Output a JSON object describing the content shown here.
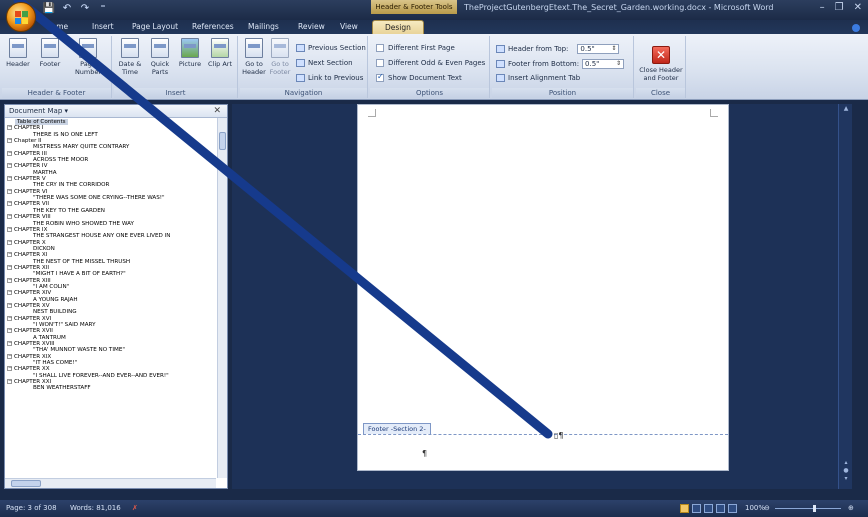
{
  "window": {
    "context_title": "Header & Footer Tools",
    "title": "TheProjectGutenbergEtext.The_Secret_Garden.working.docx - Microsoft Word",
    "minimize": "–",
    "restore": "❐",
    "close": "✕"
  },
  "qat": {
    "save": "💾",
    "undo": "↶",
    "redo": "↷",
    "more": "⁼"
  },
  "tabs": [
    "Home",
    "Insert",
    "Page Layout",
    "References",
    "Mailings",
    "Review",
    "View",
    "Design"
  ],
  "active_tab": "Design",
  "ribbon": {
    "header_footer": {
      "label": "Header & Footer",
      "header": "Header",
      "footer": "Footer",
      "page_number": "Page Number"
    },
    "insert": {
      "label": "Insert",
      "date_time": "Date & Time",
      "quick_parts": "Quick Parts",
      "picture": "Picture",
      "clip_art": "Clip Art"
    },
    "navigation": {
      "label": "Navigation",
      "go_to_header": "Go to Header",
      "go_to_footer": "Go to Footer",
      "previous_section": "Previous Section",
      "next_section": "Next Section",
      "link_to_previous": "Link to Previous"
    },
    "options": {
      "label": "Options",
      "different_first_page": "Different First Page",
      "different_odd_even": "Different Odd & Even Pages",
      "show_document_text": "Show Document Text",
      "show_document_text_checked": true,
      "different_first_page_checked": false,
      "different_odd_even_checked": false
    },
    "position": {
      "label": "Position",
      "header_from_top": "Header from Top:",
      "header_from_top_value": "0.5\"",
      "footer_from_bottom": "Footer from Bottom:",
      "footer_from_bottom_value": "0.5\"",
      "insert_alignment_tab": "Insert Alignment Tab"
    },
    "close": {
      "label": "Close",
      "close_header_footer": "Close Header and Footer"
    }
  },
  "document_map": {
    "title": "Document Map",
    "dropdown": "▾",
    "close": "✕",
    "items": [
      {
        "level": "toc",
        "text": "Table of Contents"
      },
      {
        "level": 1,
        "text": "CHAPTER I"
      },
      {
        "level": 2,
        "text": "THERE IS NO ONE LEFT"
      },
      {
        "level": 1,
        "text": "Chapter II"
      },
      {
        "level": 2,
        "text": "MISTRESS MARY QUITE CONTRARY"
      },
      {
        "level": 1,
        "text": "CHAPTER III"
      },
      {
        "level": 2,
        "text": "ACROSS THE MOOR"
      },
      {
        "level": 1,
        "text": "CHAPTER IV"
      },
      {
        "level": 2,
        "text": "MARTHA"
      },
      {
        "level": 1,
        "text": "CHAPTER V"
      },
      {
        "level": 2,
        "text": "THE CRY IN THE CORRIDOR"
      },
      {
        "level": 1,
        "text": "CHAPTER VI"
      },
      {
        "level": 2,
        "text": "\"THERE WAS SOME ONE CRYING--THERE WAS!\""
      },
      {
        "level": 1,
        "text": "CHAPTER VII"
      },
      {
        "level": 2,
        "text": "THE KEY TO THE GARDEN"
      },
      {
        "level": 1,
        "text": "CHAPTER VIII"
      },
      {
        "level": 2,
        "text": "THE ROBIN WHO SHOWED THE WAY"
      },
      {
        "level": 1,
        "text": "CHAPTER IX"
      },
      {
        "level": 2,
        "text": "THE STRANGEST HOUSE ANY ONE EVER LIVED IN"
      },
      {
        "level": 1,
        "text": "CHAPTER X"
      },
      {
        "level": 2,
        "text": "DICKON"
      },
      {
        "level": 1,
        "text": "CHAPTER XI"
      },
      {
        "level": 2,
        "text": "THE NEST OF THE MISSEL THRUSH"
      },
      {
        "level": 1,
        "text": "CHAPTER XII"
      },
      {
        "level": 2,
        "text": "\"MIGHT I HAVE A BIT OF EARTH?\""
      },
      {
        "level": 1,
        "text": "CHAPTER XIII"
      },
      {
        "level": 2,
        "text": "\"I AM COLIN\""
      },
      {
        "level": 1,
        "text": "CHAPTER XIV"
      },
      {
        "level": 2,
        "text": "A YOUNG RAJAH"
      },
      {
        "level": 1,
        "text": "CHAPTER XV"
      },
      {
        "level": 2,
        "text": "NEST BUILDING"
      },
      {
        "level": 1,
        "text": "CHAPTER XVI"
      },
      {
        "level": 2,
        "text": "\"I WON'T!\" SAID MARY"
      },
      {
        "level": 1,
        "text": "CHAPTER XVII"
      },
      {
        "level": 2,
        "text": "A TANTRUM"
      },
      {
        "level": 1,
        "text": "CHAPTER XVIII"
      },
      {
        "level": 2,
        "text": "\"THA' MUNNOT WASTE NO TIME\""
      },
      {
        "level": 1,
        "text": "CHAPTER XIX"
      },
      {
        "level": 2,
        "text": "\"IT HAS COME!\""
      },
      {
        "level": 1,
        "text": "CHAPTER XX"
      },
      {
        "level": 2,
        "text": "\"I SHALL LIVE FOREVER--AND EVER--AND EVER!\""
      },
      {
        "level": 1,
        "text": "CHAPTER XXI"
      },
      {
        "level": 2,
        "text": "BEN WEATHERSTAFF"
      }
    ]
  },
  "document": {
    "footer_tag": "Footer -Section 2-",
    "pilcrow": "¶",
    "cursor_mark": "▯¶"
  },
  "status": {
    "page": "Page: 3 of 308",
    "words": "Words: 81,016",
    "zoom": "100%",
    "zoom_out": "⊖",
    "zoom_in": "⊕"
  },
  "colors": {
    "accent_context": "#d9c48a",
    "window_dark": "#1c2b47",
    "ribbon_light": "#dbe3f0",
    "pen_stroke": "#163a8c"
  }
}
